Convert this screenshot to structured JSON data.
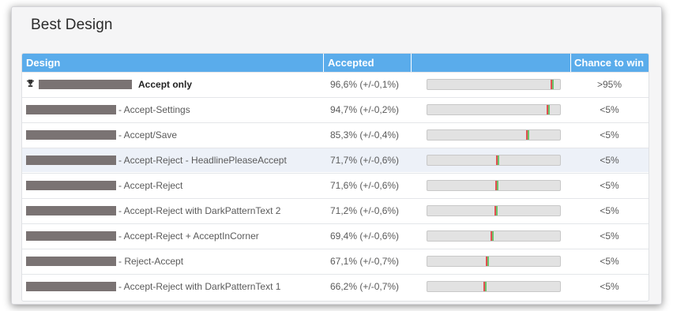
{
  "title": "Best Design",
  "columns": {
    "design": "Design",
    "accepted": "Accepted",
    "bar": "",
    "chance": "Chance to win"
  },
  "colors": {
    "header": "#5aaceb",
    "marker_red": "#e05050",
    "marker_green": "#6cc36c",
    "redaction": "#7a7373"
  },
  "rows": [
    {
      "name": "Accept only",
      "winner": true,
      "prefix": "",
      "accepted": "96,6% (+/-0,1%)",
      "value": 96.6,
      "chance": ">95%"
    },
    {
      "name": "Accept-Settings",
      "winner": false,
      "prefix": "- ",
      "accepted": "94,7% (+/-0,2%)",
      "value": 94.7,
      "chance": "<5%"
    },
    {
      "name": "Accept/Save",
      "winner": false,
      "prefix": "- ",
      "accepted": "85,3% (+/-0,4%)",
      "value": 85.3,
      "chance": "<5%"
    },
    {
      "name": "Accept-Reject - HeadlinePleaseAccept",
      "winner": false,
      "prefix": "- ",
      "accepted": "71,7% (+/-0,6%)",
      "value": 71.7,
      "chance": "<5%",
      "highlight": true
    },
    {
      "name": "Accept-Reject",
      "winner": false,
      "prefix": "- ",
      "accepted": "71,6% (+/-0,6%)",
      "value": 71.6,
      "chance": "<5%"
    },
    {
      "name": "Accept-Reject with DarkPatternText 2",
      "winner": false,
      "prefix": "- ",
      "accepted": "71,2% (+/-0,6%)",
      "value": 71.2,
      "chance": "<5%"
    },
    {
      "name": "Accept-Reject + AcceptInCorner",
      "winner": false,
      "prefix": "- ",
      "accepted": "69,4% (+/-0,6%)",
      "value": 69.4,
      "chance": "<5%"
    },
    {
      "name": "Reject-Accept",
      "winner": false,
      "prefix": "- ",
      "accepted": "67,1% (+/-0,7%)",
      "value": 67.1,
      "chance": "<5%"
    },
    {
      "name": "Accept-Reject with DarkPatternText 1",
      "winner": false,
      "prefix": "- ",
      "accepted": "66,2% (+/-0,7%)",
      "value": 66.2,
      "chance": "<5%"
    }
  ]
}
